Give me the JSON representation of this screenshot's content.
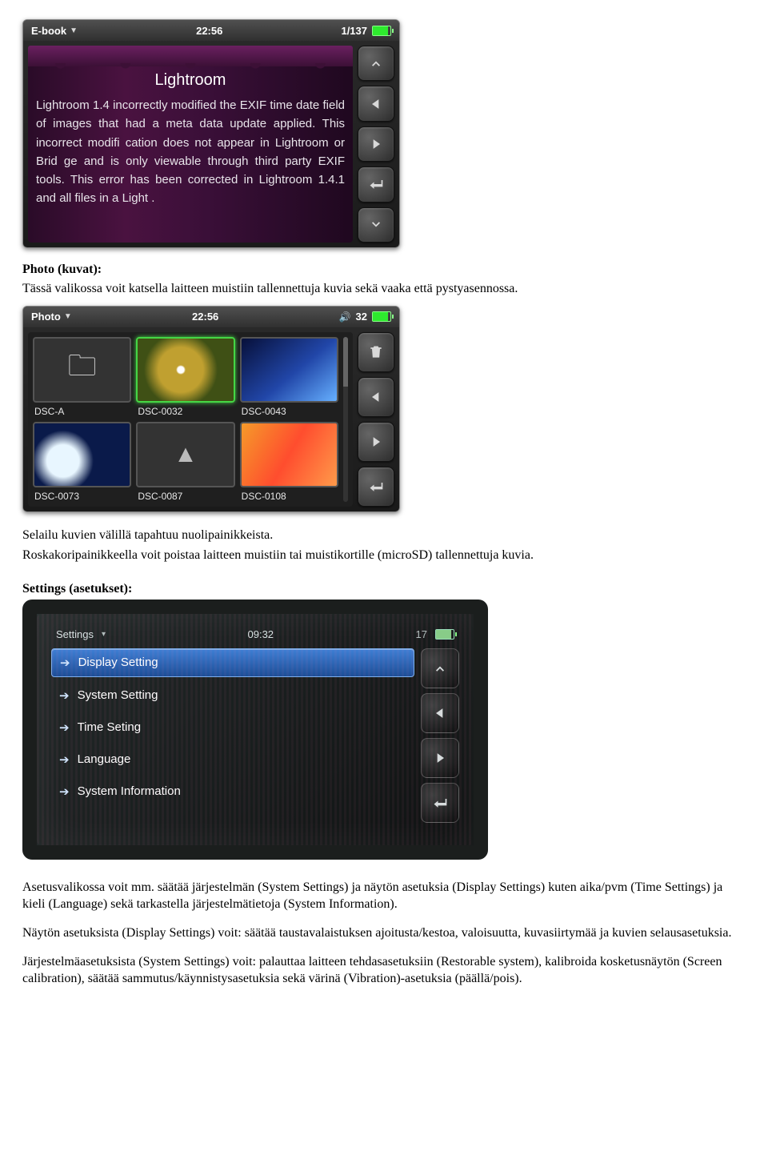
{
  "ebook": {
    "status": {
      "mode": "E-book",
      "time": "22:56",
      "page": "1/137"
    },
    "title": "Lightroom",
    "body": "Lightroom 1.4 incorrectly modified the EXIF time date field of images that had a meta data update applied. This incorrect modifi cation does not appear in Lightroom or Brid ge and is only viewable through third party EXIF tools. This error has been corrected in Lightroom 1.4.1 and all files in a Light ."
  },
  "doc_photo_heading": "Photo (kuvat):",
  "doc_photo_p1": "Tässä valikossa voit katsella laitteen muistiin tallennettuja kuvia sekä vaaka että pystyasennossa.",
  "photo": {
    "status": {
      "mode": "Photo",
      "time": "22:56",
      "vol": "32"
    },
    "thumbs": [
      {
        "label": "DSC-A"
      },
      {
        "label": "DSC-0032"
      },
      {
        "label": "DSC-0043"
      },
      {
        "label": "DSC-0073"
      },
      {
        "label": "DSC-0087"
      },
      {
        "label": "DSC-0108"
      }
    ]
  },
  "doc_photo_p2": "Selailu kuvien välillä tapahtuu nuolipainikkeista.",
  "doc_photo_p3": "Roskakoripainikkeella voit poistaa laitteen muistiin tai muistikortille (microSD) tallennettuja kuvia.",
  "doc_settings_heading": "Settings (asetukset):",
  "settings": {
    "status": {
      "mode": "Settings",
      "time": "09:32",
      "right": "17"
    },
    "items": [
      "Display Setting",
      "System Setting",
      "Time Seting",
      "Language",
      "System Information"
    ]
  },
  "doc_settings_p1": "Asetusvalikossa voit mm. säätää järjestelmän (System Settings) ja näytön asetuksia (Display Settings) kuten aika/pvm (Time Settings) ja kieli (Language) sekä tarkastella järjestelmätietoja (System Information).",
  "doc_settings_p2": "Näytön asetuksista (Display Settings) voit: säätää taustavalaistuksen ajoitusta/kestoa, valoisuutta, kuvasiirtymää ja kuvien selausasetuksia.",
  "doc_settings_p3": "Järjestelmäasetuksista (System Settings) voit: palauttaa laitteen tehdasasetuksiin (Restorable system), kalibroida kosketusnäytön (Screen calibration), säätää sammutus/käynnistysasetuksia sekä värinä (Vibration)-asetuksia (päällä/pois)."
}
